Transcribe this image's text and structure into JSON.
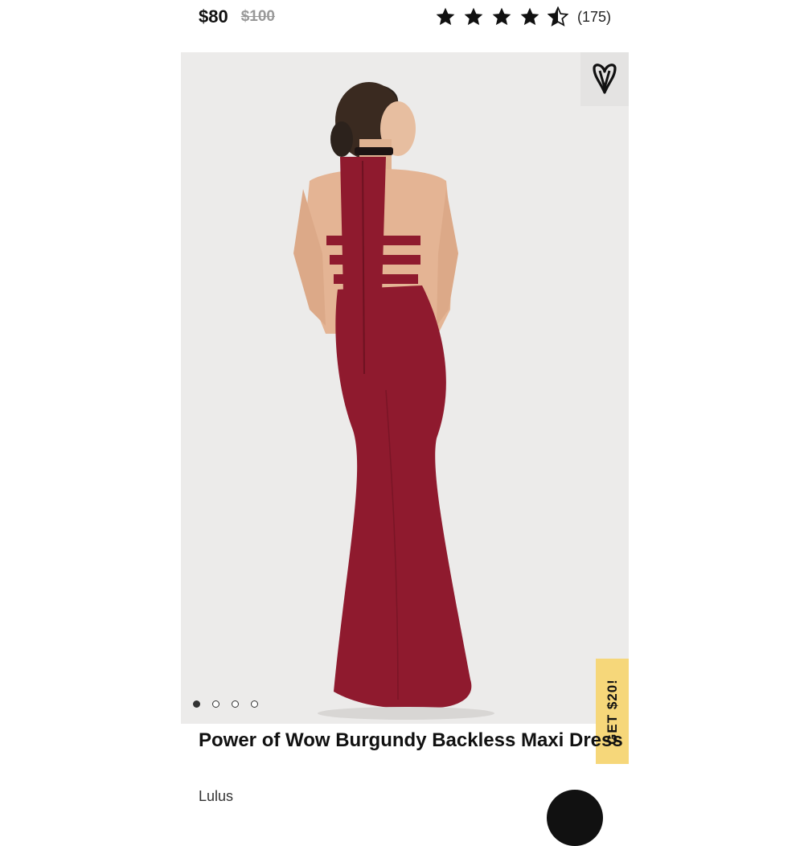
{
  "product": {
    "price": "$80",
    "original_price": "$100",
    "rating_count": "(175)",
    "rating": 4.5,
    "stars_max": 5,
    "title": "Power of Wow Burgundy Backless Maxi Dress",
    "brand": "Lulus"
  },
  "gallery": {
    "image_count": 4,
    "active_index": 0,
    "favorite_icon": "heart-v-icon"
  },
  "promo": {
    "label": "GET $20!",
    "color": "#f6d77a"
  },
  "colors": {
    "dress": "#8f1a2e",
    "background": "#ecebea"
  }
}
